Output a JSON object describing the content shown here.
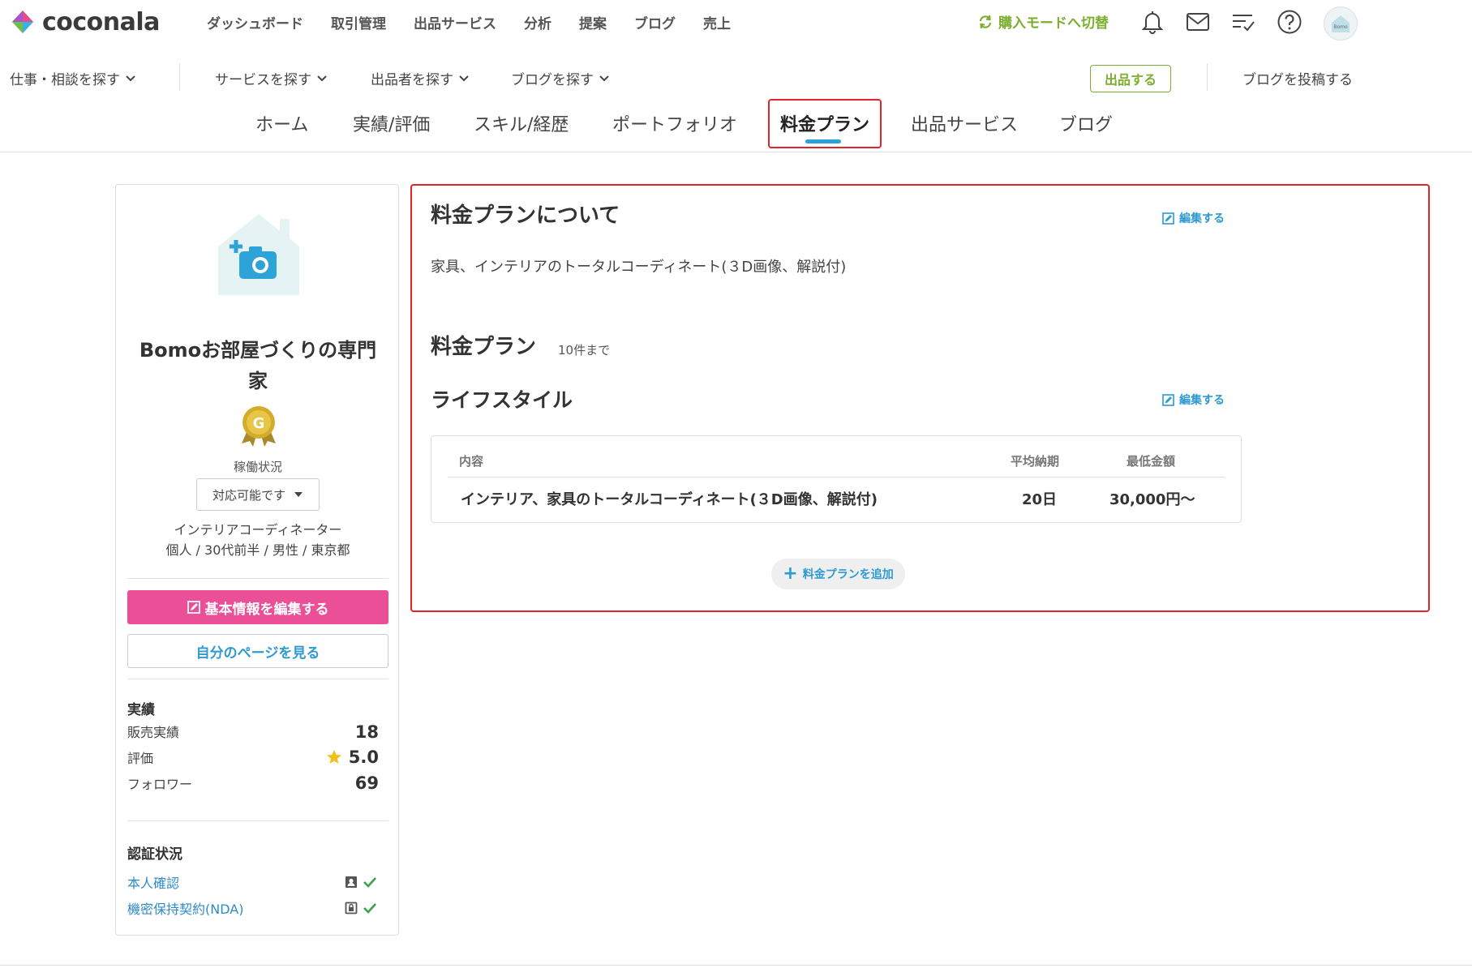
{
  "header": {
    "logo_text": "coconala",
    "nav": [
      "ダッシュボード",
      "取引管理",
      "出品サービス",
      "分析",
      "提案",
      "ブログ",
      "売上"
    ],
    "buyer_mode": "購入モードへ切替"
  },
  "subnav": {
    "items": [
      "仕事・相談を探す",
      "サービスを探す",
      "出品者を探す",
      "ブログを探す"
    ],
    "sell_button": "出品する",
    "post_blog": "ブログを投稿する"
  },
  "tabs": [
    {
      "label": "ホーム",
      "active": false
    },
    {
      "label": "実績/評価",
      "active": false
    },
    {
      "label": "スキル/経歴",
      "active": false
    },
    {
      "label": "ポートフォリオ",
      "active": false
    },
    {
      "label": "料金プラン",
      "active": true
    },
    {
      "label": "出品サービス",
      "active": false
    },
    {
      "label": "ブログ",
      "active": false
    }
  ],
  "profile": {
    "name_line1": "Bomoお部屋づくりの専門",
    "name_line2": "家",
    "badge_letter": "G",
    "status_label": "稼働状況",
    "status_value": "対応可能です",
    "job": "インテリアコーディネーター",
    "meta": "個人 /  30代前半 /  男性 /  東京都",
    "edit_basic": "基本情報を編集する",
    "view_page": "自分のページを見る",
    "stats_title": "実績",
    "stats": [
      {
        "label": "販売実績",
        "value": "18"
      },
      {
        "label": "評価",
        "value": "5.0"
      },
      {
        "label": "フォロワー",
        "value": "69"
      }
    ],
    "verify_title": "認証状況",
    "verify": [
      {
        "label": "本人確認"
      },
      {
        "label": "機密保持契約(NDA)"
      }
    ]
  },
  "main": {
    "about_title": "料金プランについて",
    "edit_label": "編集する",
    "about_text": "家具、インテリアのトータルコーディネート(３D画像、解説付)",
    "plan_title": "料金プラン",
    "plan_limit": "10件まで",
    "category_title": "ライフスタイル",
    "table": {
      "headers": [
        "内容",
        "平均納期",
        "最低金額"
      ],
      "rows": [
        {
          "content": "インテリア、家具のトータルコーディネート(３D画像、解説付)",
          "delivery": "20日",
          "price": "30,000円〜"
        }
      ]
    },
    "add_plan": "料金プランを追加"
  },
  "colors": {
    "accent_blue": "#29a3d9",
    "green": "#7cae2f",
    "pink": "#ea4f98",
    "highlight_red": "#e0242b"
  }
}
